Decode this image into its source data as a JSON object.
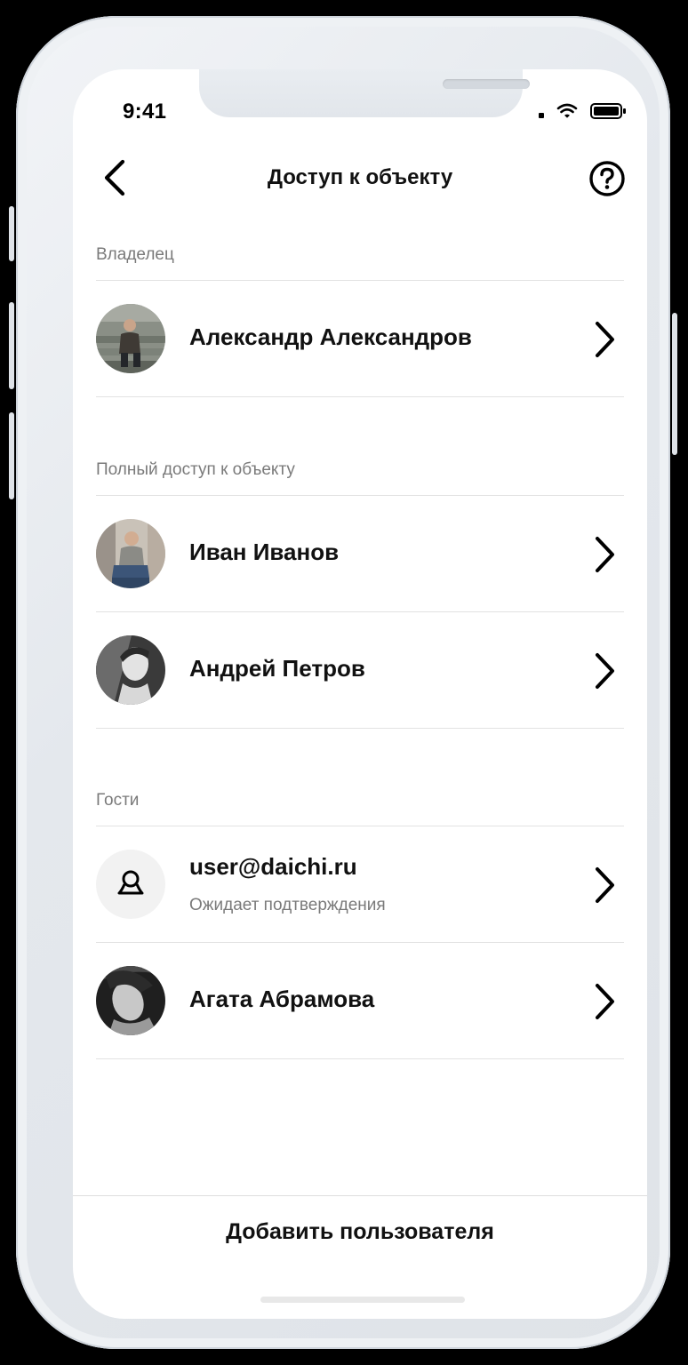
{
  "status_bar": {
    "time": "9:41"
  },
  "header": {
    "title": "Доступ к объекту",
    "back_icon": "chevron-left-icon",
    "help_icon": "question-circle-icon"
  },
  "sections": {
    "owner": {
      "label": "Владелец",
      "users": [
        {
          "name": "Александр Александров"
        }
      ]
    },
    "full_access": {
      "label": "Полный доступ к объекту",
      "users": [
        {
          "name": "Иван Иванов"
        },
        {
          "name": "Андрей Петров"
        }
      ]
    },
    "guests": {
      "label": "Гости",
      "users": [
        {
          "name": "user@daichi.ru",
          "status": "Ожидает подтверждения",
          "avatar": "user-placeholder-icon"
        },
        {
          "name": "Агата Абрамова"
        }
      ]
    }
  },
  "footer": {
    "add_button_label": "Добавить пользователя"
  }
}
